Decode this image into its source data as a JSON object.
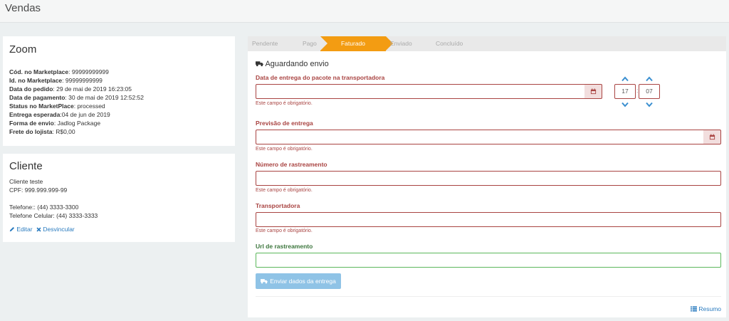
{
  "page": {
    "title": "Vendas"
  },
  "order": {
    "title": "Zoom",
    "fields": [
      {
        "label": "Cód. no Marketplace",
        "sep": ": ",
        "value": "99999999999"
      },
      {
        "label": "Id. no Marketplace",
        "sep": ": ",
        "value": "99999999999"
      },
      {
        "label": "Data do pedido",
        "sep": ": ",
        "value": "29 de mai de 2019 16:23:05"
      },
      {
        "label": "Data de pagamento",
        "sep": ": ",
        "value": "30 de mai de 2019 12:52:52"
      },
      {
        "label": "Status no MarketPlace",
        "sep": ": ",
        "value": "processed"
      },
      {
        "label": "Entrega esperada",
        "sep": ":",
        "value": "04 de jun de 2019"
      },
      {
        "label": "Forma de envio",
        "sep": ": ",
        "value": "Jadlog Package"
      },
      {
        "label": "Frete do lojista",
        "sep": ": ",
        "value": "R$0,00"
      }
    ]
  },
  "client": {
    "title": "Cliente",
    "name": "Cliente teste",
    "cpf": "CPF: 999.999.999-99",
    "phone": "Telefone:: (44) 3333-3300",
    "mobile": "Telefone Celular: (44) 3333-3333",
    "edit_label": "Editar",
    "unlink_label": "Desvincular"
  },
  "steps": [
    {
      "label": "Pendente",
      "state": "done"
    },
    {
      "label": "Pago",
      "state": "done"
    },
    {
      "label": "Faturado",
      "state": "active"
    },
    {
      "label": "Enviado",
      "state": "todo"
    },
    {
      "label": "Concluído",
      "state": "todo"
    }
  ],
  "shipping": {
    "status_title": "Aguardando envio",
    "delivery_date": {
      "label": "Data de entrega do pacote na transportadora",
      "value": "",
      "error": "Este campo é obrigatório."
    },
    "time": {
      "hour": "17",
      "minute": "07",
      "separator": ":"
    },
    "forecast": {
      "label": "Previsão de entrega",
      "value": "",
      "error": "Este campo é obrigatório."
    },
    "tracking_number": {
      "label": "Número de rastreamento",
      "value": "",
      "error": "Este campo é obrigatório."
    },
    "carrier": {
      "label": "Transportadora",
      "value": "",
      "error": "Este campo é obrigatório."
    },
    "tracking_url": {
      "label": "Url de rastreamento",
      "value": ""
    },
    "submit_label": "Enviar dados da entrega",
    "summary_label": "Resumo"
  },
  "colors": {
    "accent": "#f39c12",
    "error": "#a94442",
    "success": "#3c763d",
    "link": "#2a7bbf",
    "button": "#8fc3e6"
  }
}
